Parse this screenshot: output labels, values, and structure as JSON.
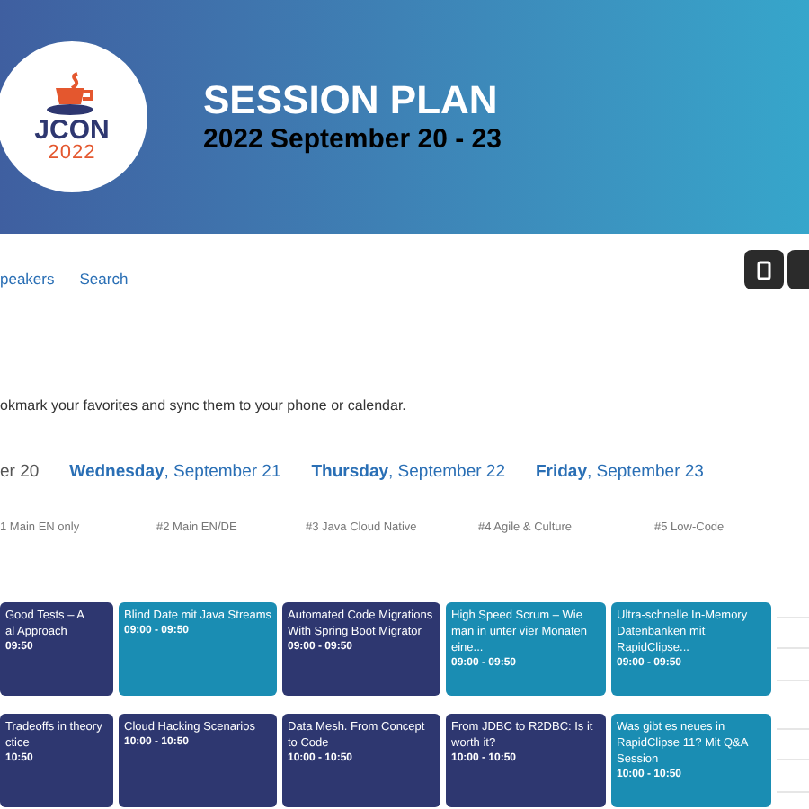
{
  "header": {
    "logo_text": "JCON",
    "logo_year": "2022",
    "title": "SESSION PLAN",
    "subtitle": "2022 September 20 - 23"
  },
  "nav": [
    {
      "label": "peakers"
    },
    {
      "label": "Search"
    }
  ],
  "intro": "okmark your favorites and sync them to your phone or calendar.",
  "days": [
    {
      "date": "er 20",
      "selected": true
    },
    {
      "day": "Wednesday",
      "date": ", September 21",
      "selected": false
    },
    {
      "day": "Thursday",
      "date": ", September 22",
      "selected": false
    },
    {
      "day": "Friday",
      "date": ", September 23",
      "selected": false
    }
  ],
  "tracks": [
    "1 Main EN only",
    "#2 Main EN/DE",
    "#3 Java Cloud Native",
    "#4 Agile & Culture",
    "#5 Low-Code"
  ],
  "rows": [
    {
      "sessions": [
        {
          "title": "Good Tests – A\nal Approach",
          "time": "09:50",
          "color": "#2e3770"
        },
        {
          "title": "Blind Date mit Java Streams",
          "time": "09:00 - 09:50",
          "color": "#1a8db3"
        },
        {
          "title": "Automated Code Migrations With Spring Boot Migrator",
          "time": "09:00 - 09:50",
          "color": "#2e3770"
        },
        {
          "title": "High Speed Scrum – Wie man in unter vier Monaten eine...",
          "time": "09:00 - 09:50",
          "color": "#1a8db3"
        },
        {
          "title": "Ultra-schnelle In-Memory Datenbanken mit RapidClipse...",
          "time": "09:00 - 09:50",
          "color": "#1a8db3"
        }
      ]
    },
    {
      "sessions": [
        {
          "title": "Tradeoffs in theory\nctice",
          "time": "10:50",
          "color": "#2e3770"
        },
        {
          "title": "Cloud Hacking Scenarios",
          "time": "10:00 - 10:50",
          "color": "#2e3770"
        },
        {
          "title": "Data Mesh. From Concept to Code",
          "time": "10:00 - 10:50",
          "color": "#2e3770"
        },
        {
          "title": "From JDBC to R2DBC: Is it worth it?",
          "time": "10:00 - 10:50",
          "color": "#2e3770"
        },
        {
          "title": "Was gibt es neues in RapidClipse 11? Mit Q&A Session",
          "time": "10:00 - 10:50",
          "color": "#1a8db3"
        }
      ]
    }
  ]
}
